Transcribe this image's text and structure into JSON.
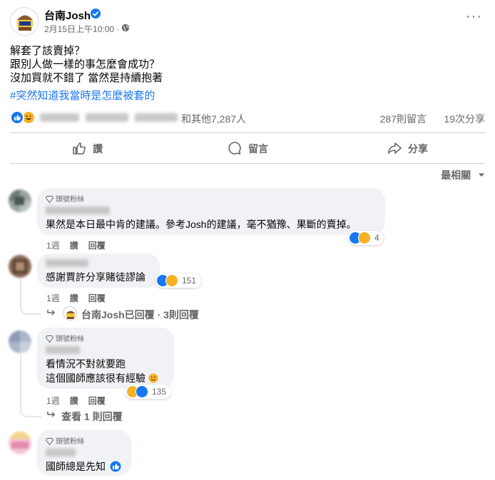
{
  "post": {
    "page_name": "台南Josh",
    "timestamp": "2月15日上午10:00 · ",
    "lines": [
      "解套了該賣掉？",
      "跟別人做一樣的事怎麼會成功？",
      "沒加買就不錯了 當然是持續抱著"
    ],
    "hashtag": "#突然知道我當時是怎麼被套的",
    "reactions": {
      "others_text": "和其他7,287人",
      "comments_count": "287則留言",
      "shares_count": "19次分享"
    },
    "actions": {
      "like": "讚",
      "comment": "留言",
      "share": "分享"
    },
    "sort_label": "最相關"
  },
  "comments": [
    {
      "badge": "頭號粉絲",
      "text": "果然是本日最中肯的建議。參考Josh的建議，毫不猶豫、果斷的賣掉。",
      "time": "1週",
      "like": "讚",
      "reply": "回覆",
      "reaction_count": "4"
    },
    {
      "text": "感謝賈許分享賭徒謬論",
      "time": "1週",
      "like": "讚",
      "reply": "回覆",
      "reaction_count": "151",
      "reply_summary": "台南Josh已回覆 · 3則回覆"
    },
    {
      "badge": "頭號粉絲",
      "lines": [
        "看情況不對就要跑",
        "這個國師應該很有經驗"
      ],
      "time": "1週",
      "like": "讚",
      "reply": "回覆",
      "reaction_count": "135",
      "reply_summary": "查看 1 則回覆"
    },
    {
      "badge": "頭號粉絲",
      "text": "國師總是先知"
    }
  ],
  "colors": {
    "accent": "#1877f2",
    "muted": "#65676b",
    "bubble": "#f0f2f5",
    "haha": "#f7b125"
  },
  "icons": [
    "verified-icon",
    "globe-icon",
    "more-icon",
    "like-icon",
    "comment-icon",
    "share-icon",
    "chevron-down-icon",
    "diamond-icon",
    "reply-arrow-icon"
  ]
}
